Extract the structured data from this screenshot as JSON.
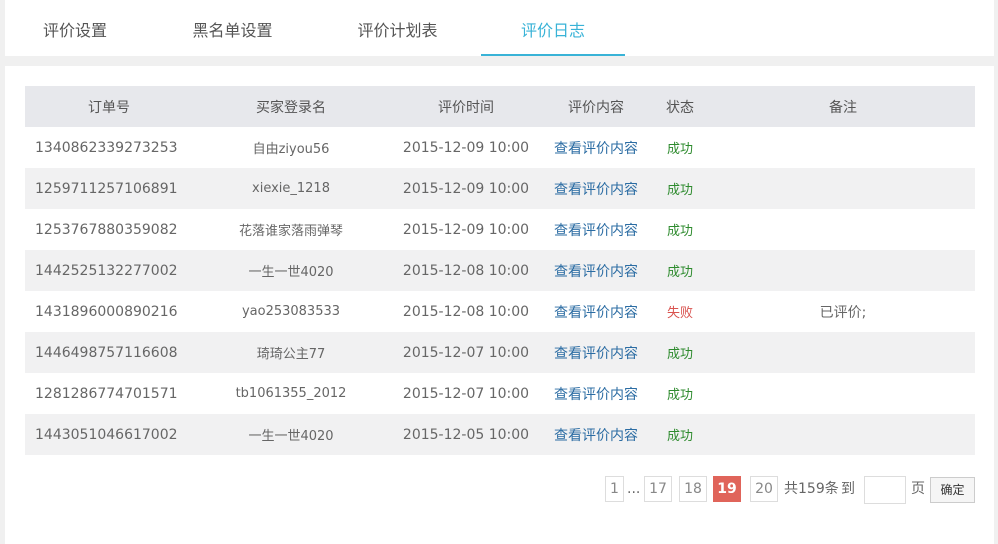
{
  "tabs": [
    {
      "label": "评价设置"
    },
    {
      "label": "黑名单设置"
    },
    {
      "label": "评价计划表"
    },
    {
      "label": "评价日志"
    }
  ],
  "table": {
    "headers": [
      "订单号",
      "买家登录名",
      "评价时间",
      "评价内容",
      "状态",
      "备注"
    ],
    "rows": [
      {
        "order": "1340862339273253",
        "buyer": "自由ziyou56",
        "time": "2015-12-09 10:00",
        "content": "查看评价内容",
        "status": "成功",
        "note": ""
      },
      {
        "order": "1259711257106891",
        "buyer": "xiexie_1218",
        "time": "2015-12-09 10:00",
        "content": "查看评价内容",
        "status": "成功",
        "note": ""
      },
      {
        "order": "1253767880359082",
        "buyer": "花落谁家落雨弹琴",
        "time": "2015-12-09 10:00",
        "content": "查看评价内容",
        "status": "成功",
        "note": ""
      },
      {
        "order": "1442525132277002",
        "buyer": "一生一世4020",
        "time": "2015-12-08 10:00",
        "content": "查看评价内容",
        "status": "成功",
        "note": ""
      },
      {
        "order": "1431896000890216",
        "buyer": "yao253083533",
        "time": "2015-12-08 10:00",
        "content": "查看评价内容",
        "status": "失败",
        "note": "已评价;"
      },
      {
        "order": "1446498757116608",
        "buyer": "琦琦公主77",
        "time": "2015-12-07 10:00",
        "content": "查看评价内容",
        "status": "成功",
        "note": ""
      },
      {
        "order": "1281286774701571",
        "buyer": "tb1061355_2012",
        "time": "2015-12-07 10:00",
        "content": "查看评价内容",
        "status": "成功",
        "note": ""
      },
      {
        "order": "1443051046617002",
        "buyer": "一生一世4020",
        "time": "2015-12-05 10:00",
        "content": "查看评价内容",
        "status": "成功",
        "note": ""
      }
    ]
  },
  "pagination": {
    "first": "1",
    "ellipsis": "...",
    "p17": "17",
    "p18": "18",
    "current": "19",
    "p20": "20",
    "total": "共159条",
    "goto": "到",
    "page_unit": "页",
    "confirm": "确定"
  },
  "colors": {
    "accent": "#39b3d7",
    "success": "#2e8b2e",
    "fail": "#d9534f",
    "link": "#2b6ca3",
    "current_page": "#e0645a"
  }
}
